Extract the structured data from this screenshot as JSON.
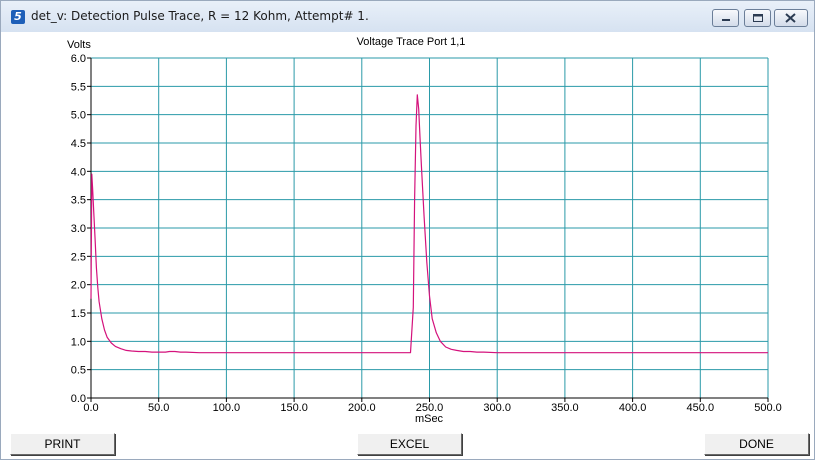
{
  "window": {
    "title": "det_v: Detection Pulse Trace, R = 12 Kohm, Attempt# 1.",
    "app_icon_glyph": "5",
    "controls": [
      "minimize-icon",
      "maximize-icon",
      "close-icon"
    ]
  },
  "buttons": {
    "print": "PRINT",
    "excel": "EXCEL",
    "done": "DONE"
  },
  "colors": {
    "grid": "#2a9aa8",
    "trace": "#d4127c",
    "axis": "#000000"
  },
  "chart_data": {
    "type": "line",
    "title": "Voltage Trace Port 1,1",
    "ylabel": "Volts",
    "xlabel": "mSec",
    "xlim": [
      0,
      500
    ],
    "ylim": [
      0,
      6
    ],
    "x_ticks": [
      "0.0",
      "50.0",
      "100.0",
      "150.0",
      "200.0",
      "250.0",
      "300.0",
      "350.0",
      "400.0",
      "450.0",
      "500.0"
    ],
    "y_ticks": [
      "0.0",
      "0.5",
      "1.0",
      "1.5",
      "2.0",
      "2.5",
      "3.0",
      "3.5",
      "4.0",
      "4.5",
      "5.0",
      "5.5",
      "6.0"
    ],
    "grid": true,
    "series": [
      {
        "x": [
          0,
          0.6,
          1.2,
          2,
          3,
          4,
          5,
          6,
          8,
          10,
          12,
          15,
          18,
          22,
          26,
          30,
          35,
          40,
          45,
          50,
          55,
          58,
          62,
          66,
          70,
          80,
          100,
          150,
          200,
          236,
          238,
          239,
          240,
          241,
          242,
          243,
          244,
          246,
          248,
          250,
          252,
          255,
          258,
          262,
          266,
          270,
          275,
          280,
          285,
          290,
          300,
          350,
          400,
          450,
          500
        ],
        "y": [
          1.75,
          3.95,
          3.7,
          3.3,
          2.8,
          2.3,
          1.95,
          1.7,
          1.4,
          1.2,
          1.07,
          0.97,
          0.91,
          0.87,
          0.84,
          0.83,
          0.82,
          0.82,
          0.81,
          0.81,
          0.81,
          0.82,
          0.82,
          0.81,
          0.81,
          0.8,
          0.8,
          0.8,
          0.8,
          0.8,
          1.6,
          3.5,
          4.8,
          5.35,
          5.1,
          4.6,
          4.1,
          3.2,
          2.4,
          1.8,
          1.4,
          1.15,
          1.0,
          0.9,
          0.86,
          0.84,
          0.82,
          0.82,
          0.81,
          0.81,
          0.8,
          0.8,
          0.8,
          0.8,
          0.8
        ]
      }
    ]
  }
}
